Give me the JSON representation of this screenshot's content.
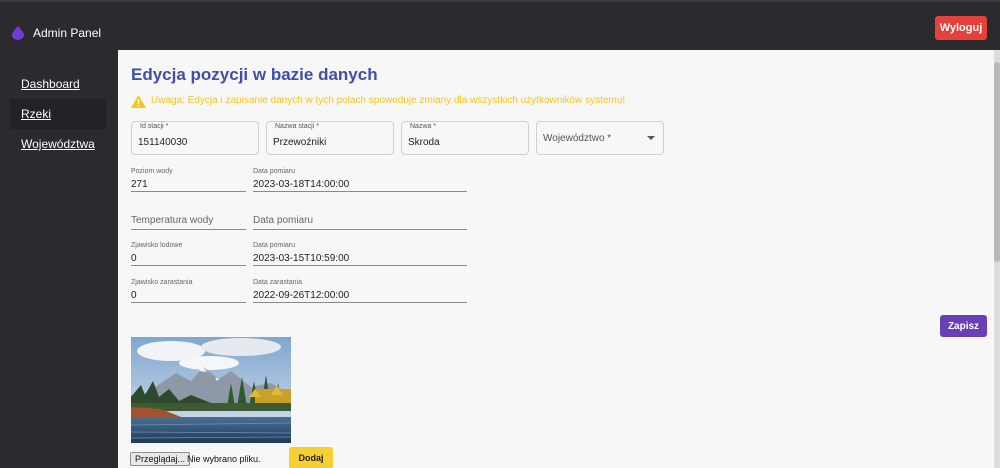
{
  "header": {
    "title": "Admin Panel",
    "logout_label": "Wyloguj"
  },
  "sidebar": {
    "items": [
      {
        "label": "Dashboard",
        "active": false
      },
      {
        "label": "Rzeki",
        "active": true
      },
      {
        "label": "Województwa",
        "active": false
      }
    ]
  },
  "page": {
    "title": "Edycja pozycji w bazie danych",
    "warning": "Uwaga: Edycja i zapisanie danych w tych polach spowoduje zmiany dla wszystkich użytkowników systemu!"
  },
  "fields": {
    "station_id": {
      "label": "Id stacji *",
      "value": "151140030"
    },
    "station_name": {
      "label": "Nazwa stacji *",
      "value": "Przewoźniki"
    },
    "name": {
      "label": "Nazwa *",
      "value": "Skroda"
    },
    "voivodeship": {
      "placeholder": "Województwo *"
    },
    "water_level": {
      "label": "Poziom wody",
      "value": "271"
    },
    "water_level_date": {
      "label": "Data pomiaru",
      "value": "2023-03-18T14:00:00"
    },
    "water_temp": {
      "placeholder": "Temperatura wody"
    },
    "water_temp_date": {
      "placeholder": "Data pomiaru"
    },
    "ice": {
      "label": "Zjawisko lodowe",
      "value": "0"
    },
    "ice_date": {
      "label": "Data pomiaru",
      "value": "2023-03-15T10:59:00"
    },
    "overgrowth": {
      "label": "Zjawisko zarastania",
      "value": "0"
    },
    "overgrowth_date": {
      "label": "Data zarastania",
      "value": "2022-09-26T12:00:00"
    }
  },
  "actions": {
    "save_label": "Zapisz",
    "browse_label": "Przeglądaj...",
    "file_status": "Nie wybrano pliku.",
    "add_label": "Dodaj"
  },
  "colors": {
    "accent": "#3f4fa8",
    "logout": "#e5413a",
    "save": "#6a3fb5",
    "warning": "#f2c61f",
    "add": "#f5d033"
  },
  "icons": {
    "logo": "drop-icon",
    "warning": "warning-triangle-icon",
    "select": "caret-down-icon"
  }
}
